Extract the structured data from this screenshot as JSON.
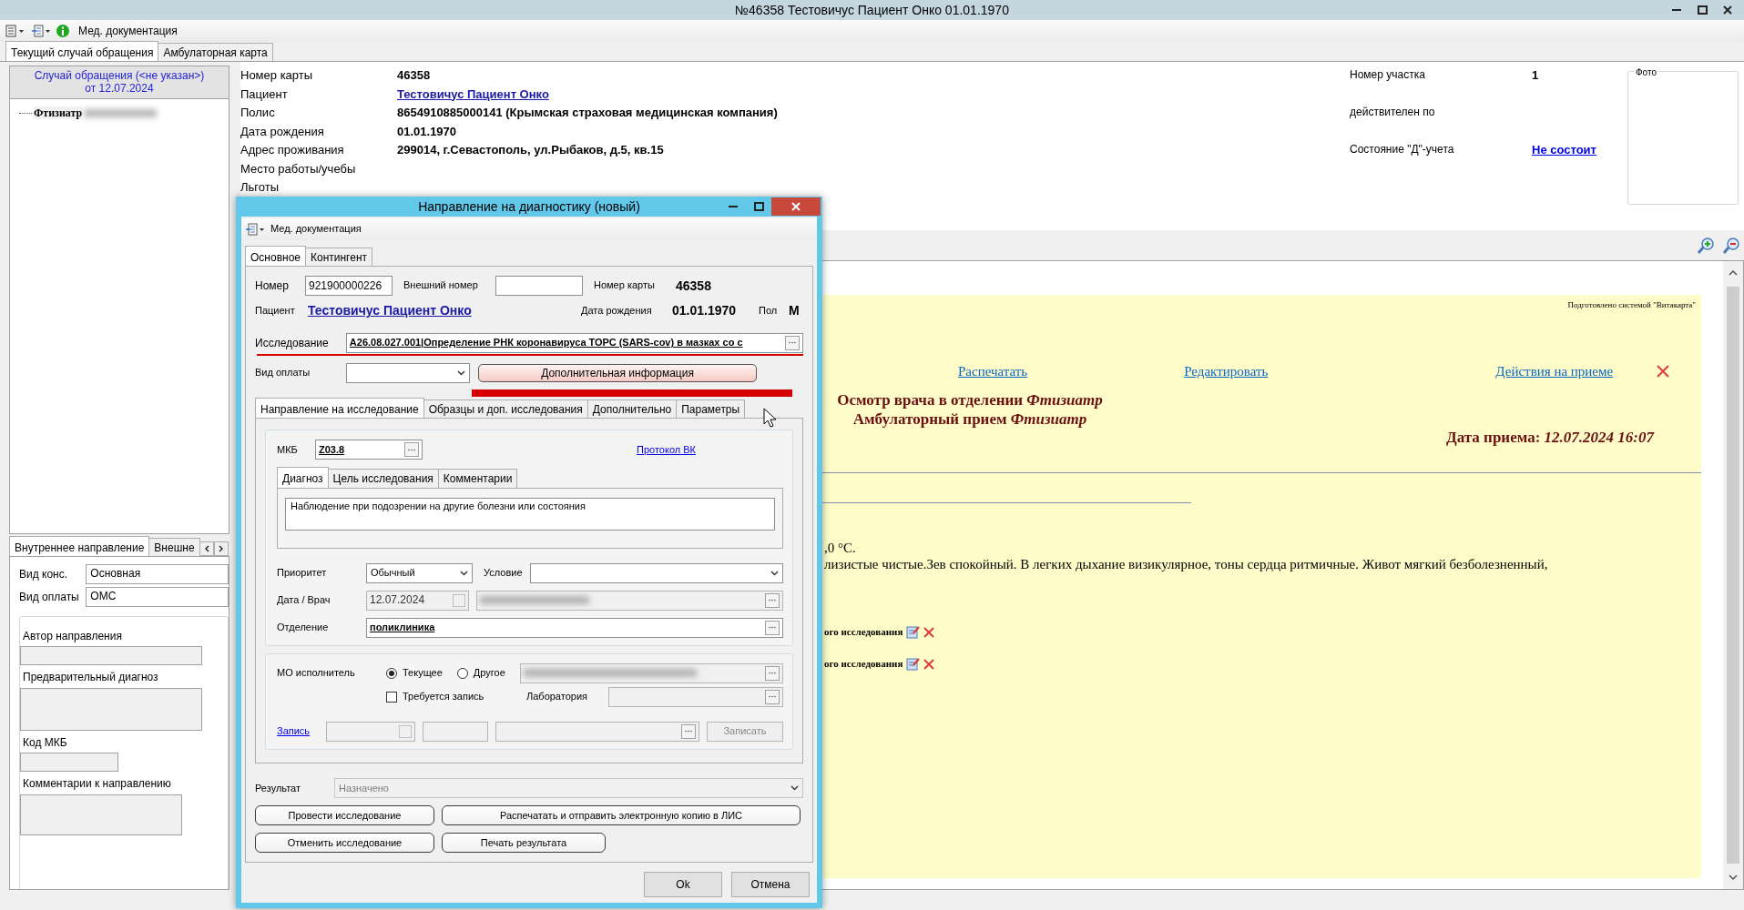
{
  "window": {
    "title": "№46358 Тестовичус Пациент Онко 01.01.1970"
  },
  "toolbar": {
    "label": "Мед. документация"
  },
  "tabs": [
    {
      "label": "Текущий случай обращения",
      "selected": true
    },
    {
      "label": "Амбулаторная карта",
      "selected": false
    }
  ],
  "case_panel": {
    "header": [
      "Случай обращения (<не указан>)",
      "от 12.07.2024"
    ],
    "tree": [
      {
        "label": "Фтизиатр"
      }
    ]
  },
  "referral_panel": {
    "tabs": [
      {
        "label": "Внутреннее направление",
        "selected": true
      },
      {
        "label": "Внешне",
        "selected": false
      }
    ],
    "fields": [
      {
        "label": "Вид конс.",
        "value": "Основная"
      },
      {
        "label": "Вид оплаты",
        "value": "ОМС"
      }
    ],
    "group": [
      {
        "label": "Автор направления",
        "kind": "field"
      },
      {
        "label": "Предварительный диагноз",
        "kind": "area"
      },
      {
        "label": "Код МКБ",
        "kind": "short"
      },
      {
        "label": "Комментарии к направлению",
        "kind": "area"
      }
    ]
  },
  "patient": {
    "left": [
      {
        "label": "Номер карты",
        "value": "46358",
        "kind": "text"
      },
      {
        "label": "Пациент",
        "value": "Тестовичус Пациент Онко",
        "kind": "link"
      },
      {
        "label": "Полис",
        "value": "8654910885000141 (Крымская страховая медицинская компания)",
        "kind": "text"
      },
      {
        "label": "Дата рождения",
        "value": "01.01.1970",
        "kind": "text"
      },
      {
        "label": "Адрес проживания",
        "value": "299014, г.Севастополь, ул.Рыбаков, д.5, кв.15",
        "kind": "text"
      },
      {
        "label": "Место работы/учебы"
      },
      {
        "label": "Льготы"
      }
    ],
    "right": [
      {
        "label": "Номер участка",
        "value": "1",
        "kind": "text"
      },
      {
        "label": "действителен по"
      },
      {
        "label": "Состояние \"Д\"-учета",
        "value": "Не состоит",
        "kind": "link"
      }
    ],
    "photo_label": "Фото"
  },
  "document": {
    "system_note": "Подготовлено системой \"Витакарта\"",
    "links": [
      "Распечатать",
      "Редактировать",
      "Действия на приеме"
    ],
    "headings": [
      "Осмотр врача в отделении *Фтизиатр*",
      "Амбулаторный прием *Фтизиатр*"
    ],
    "visit_date": "Дата приема: *12.07.2024 16:07*",
    "text_lines": [
      ",0 °С.",
      "лизистые чистые.Зев спокойный. В легких дыхание визикулярное, тоны сердца ритмичные. Живот мягкий безболезненный,"
    ],
    "research_items": [
      "ого исследования",
      "ого исследования"
    ]
  },
  "dialog": {
    "title": "Направление на диагностику (новый)",
    "toolbar_label": "Мед. документация",
    "tabs": [
      {
        "label": "Основное",
        "selected": true
      },
      {
        "label": "Контингент",
        "selected": false
      }
    ],
    "number": {
      "label": "Номер",
      "value": "921900000226"
    },
    "external_number": {
      "label": "Внешний номер"
    },
    "card_number": {
      "label": "Номер карты",
      "value": "46358"
    },
    "patient": {
      "label": "Пациент",
      "value": "Тестовичус Пациент Онко"
    },
    "birth_date": {
      "label": "Дата рождения",
      "value": "01.01.1970"
    },
    "sex": {
      "label": "Пол",
      "value": "М"
    },
    "study": {
      "label": "Исследование",
      "value": "A26.08.027.001|Определение РНК коронавируса ТОРС (SARS-cov) в мазках со с"
    },
    "payment": {
      "label": "Вид оплаты"
    },
    "info_button": "Дополнительная информация",
    "inner_tabs": [
      {
        "label": "Направление на исследование",
        "selected": true
      },
      {
        "label": "Образцы и доп. исследования",
        "selected": false
      },
      {
        "label": "Дополнительно",
        "selected": false
      },
      {
        "label": "Параметры",
        "selected": false
      }
    ],
    "mkb": {
      "label": "МКБ",
      "value": "Z03.8"
    },
    "protocol_link": "Протокол ВК",
    "diag_tabs": [
      {
        "label": "Диагноз",
        "selected": true
      },
      {
        "label": "Цель исследования",
        "selected": false
      },
      {
        "label": "Комментарии",
        "selected": false
      }
    ],
    "diagnosis_text": "Наблюдение при подозрении на другие болезни или состояния",
    "priority": {
      "label": "Приоритет",
      "value": "Обычный"
    },
    "condition": {
      "label": "Условие"
    },
    "date_doctor": {
      "label": "Дата / Врач",
      "value": "12.07.2024"
    },
    "department": {
      "label": "Отделение",
      "value": "поликлиника"
    },
    "executor": {
      "label": "МО исполнитель",
      "options": [
        {
          "label": "Текущее",
          "selected": true
        },
        {
          "label": "Другое",
          "selected": false
        }
      ]
    },
    "requires_booking": {
      "label": "Требуется запись",
      "checked": false
    },
    "laboratory": {
      "label": "Лаборатория"
    },
    "booking": {
      "link": "Запись",
      "button": "Записать"
    },
    "result": {
      "label": "Результат",
      "value": "Назначено"
    },
    "actions": [
      [
        "Провести исследование",
        "Распечатать и отправить электронную копию в ЛИС"
      ],
      [
        "Отменить исследование",
        "Печать результата"
      ]
    ],
    "footer_buttons": [
      "Ok",
      "Отмена"
    ]
  }
}
